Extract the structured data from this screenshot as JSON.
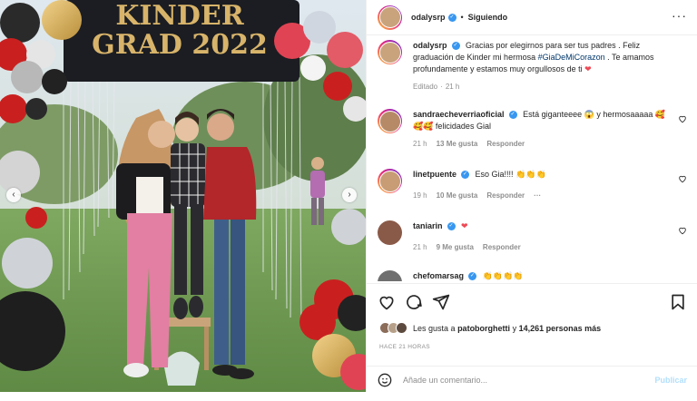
{
  "post": {
    "author": {
      "username": "odalysrp",
      "verified": true
    },
    "follow_status": "Siguiendo",
    "separator": "•",
    "more_icon": "more-horizontal-icon",
    "photo": {
      "banner_line1": "KINDER",
      "banner_line2": "GRAD 2022",
      "prev_icon": "chevron-left-icon",
      "next_icon": "chevron-right-icon"
    }
  },
  "caption": {
    "username": "odalysrp",
    "text_before": "Gracias por elegirnos para ser tus padres . Feliz graduación de Kinder mi hermosa",
    "hashtag": "#GiaDeMiCorazon",
    "text_after": ". Te amamos profundamente y estamos muy orgullosos de ti",
    "emoji": "❤",
    "edited": "Editado",
    "separator": "·",
    "time": "21 h"
  },
  "comments": [
    {
      "username": "sandraecheverriaoficial",
      "text": "Está giganteeee 😱 y hermosaaaaa 🥰🥰🥰 felicidades Gial",
      "time": "21 h",
      "likes": "13 Me gusta",
      "reply": "Responder",
      "options": ""
    },
    {
      "username": "linetpuente",
      "text": "Eso Gia!!!! 👏👏👏",
      "time": "19 h",
      "likes": "10 Me gusta",
      "reply": "Responder",
      "options": "···"
    },
    {
      "username": "taniarin",
      "text": "❤",
      "time": "21 h",
      "likes": "9 Me gusta",
      "reply": "Responder",
      "options": ""
    },
    {
      "username": "chefomarsag",
      "text": "👏👏👏👏",
      "time": "",
      "likes": "",
      "reply": "",
      "options": ""
    }
  ],
  "actions": {
    "like_icon": "heart-icon",
    "comment_icon": "comment-icon",
    "share_icon": "share-icon",
    "save_icon": "bookmark-icon"
  },
  "likes": {
    "prefix": "Les gusta a",
    "user": "patoborghetti",
    "connector": "y",
    "count": "14,261",
    "suffix": "personas más"
  },
  "timestamp": "HACE 21 HORAS",
  "add_comment": {
    "placeholder": "Añade un comentario...",
    "publish": "Publicar",
    "emoji_icon": "smiley-icon"
  },
  "colors": {
    "verified": "#3897f0",
    "hashtag": "#00376b",
    "publish_disabled": "#b2dffc",
    "heart": "#ed4956"
  }
}
